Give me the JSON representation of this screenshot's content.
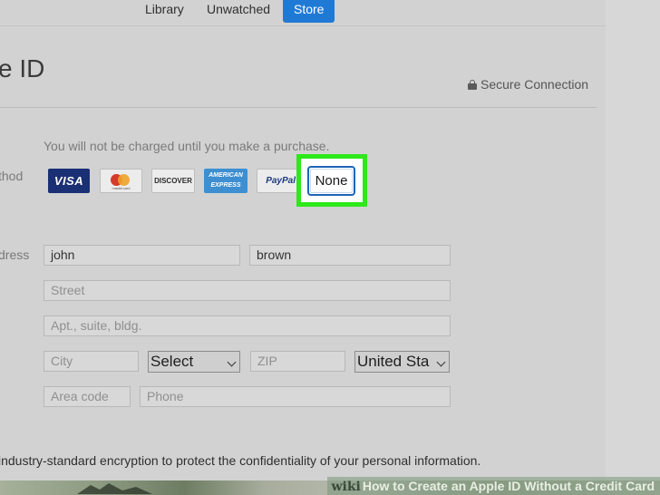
{
  "tabs": [
    {
      "label": "Library",
      "active": false
    },
    {
      "label": "Unwatched",
      "active": false
    },
    {
      "label": "Store",
      "active": true
    }
  ],
  "header": {
    "title_fragment": "e ID",
    "secure_label": "Secure Connection"
  },
  "payment": {
    "note": "You will not be charged until you make a purchase.",
    "method_label_fragment": "thod",
    "cards": [
      "VISA",
      "mastercard",
      "DISCOVER",
      "AMERICAN EXPRESS",
      "PayPal"
    ],
    "none_label": "None"
  },
  "address": {
    "label_fragment": "dress",
    "first_name": "john",
    "last_name": "brown",
    "street_placeholder": "Street",
    "apt_placeholder": "Apt., suite, bldg.",
    "city_placeholder": "City",
    "state_value": "Select",
    "zip_placeholder": "ZIP",
    "country_value": "United Sta",
    "area_code_placeholder": "Area code",
    "phone_placeholder": "Phone"
  },
  "footer": {
    "encryption_text": "industry-standard encryption to protect the confidentiality of your personal information."
  },
  "watermark": {
    "brand": "wiki",
    "text": "How to Create an Apple ID Without a Credit Card"
  },
  "colors": {
    "accent": "#1f7ad6",
    "highlight": "#2ee81a",
    "background": "#d2d2d2"
  }
}
